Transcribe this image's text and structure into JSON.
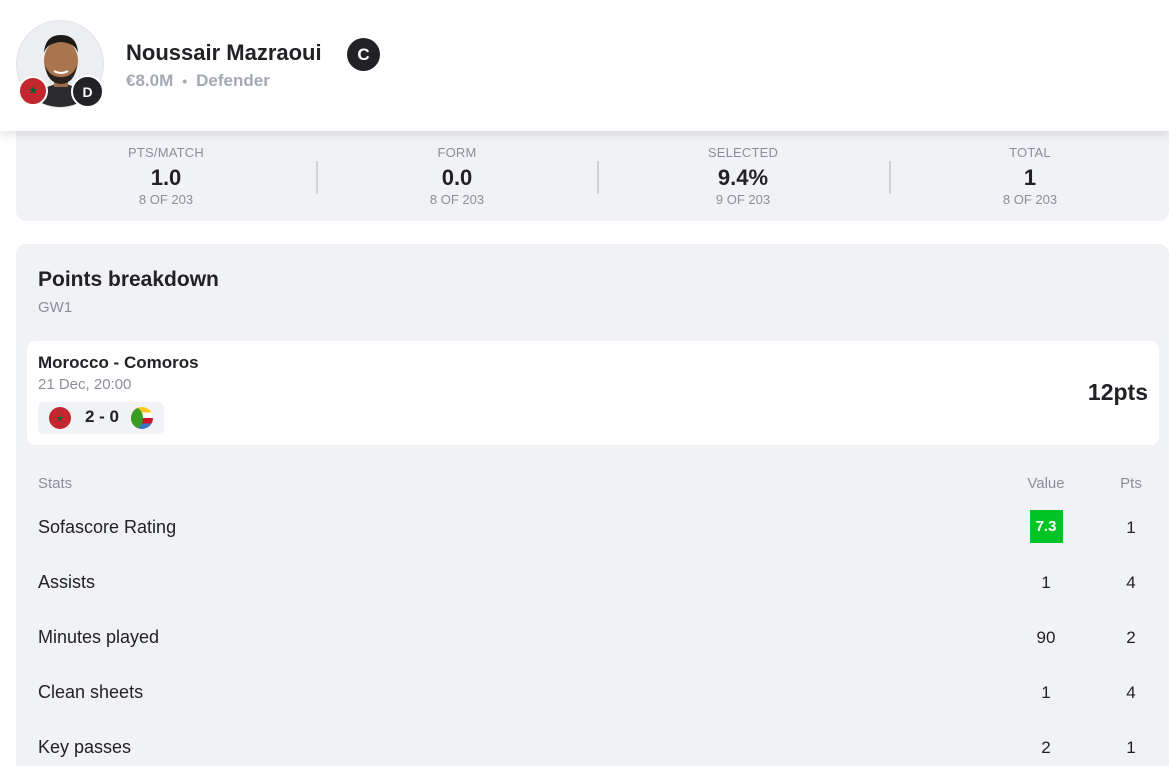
{
  "player": {
    "name": "Noussair Mazraoui",
    "captain_label": "C",
    "position_badge": "D",
    "price": "€8.0M",
    "separator": "•",
    "position": "Defender",
    "flag_icon": "morocco-flag-icon",
    "flag_glyph": "★"
  },
  "summary_stats": [
    {
      "label": "PTS/MATCH",
      "value": "1.0",
      "rank": "8 OF 203"
    },
    {
      "label": "FORM",
      "value": "0.0",
      "rank": "8 OF 203"
    },
    {
      "label": "SELECTED",
      "value": "9.4%",
      "rank": "9 OF 203"
    },
    {
      "label": "TOTAL",
      "value": "1",
      "rank": "8 OF 203"
    }
  ],
  "breakdown": {
    "title": "Points breakdown",
    "gameweek": "GW1",
    "match": {
      "title": "Morocco - Comoros",
      "date": "21 Dec, 20:00",
      "score": "2 - 0",
      "home_flag": "morocco-flag-icon",
      "away_flag": "comoros-flag-icon",
      "points": "12pts"
    },
    "columns": {
      "stat": "Stats",
      "value": "Value",
      "pts": "Pts"
    },
    "rows": [
      {
        "label": "Sofascore Rating",
        "value": "7.3",
        "pts": "1",
        "highlight_color": "#00c424"
      },
      {
        "label": "Assists",
        "value": "1",
        "pts": "4"
      },
      {
        "label": "Minutes played",
        "value": "90",
        "pts": "2"
      },
      {
        "label": "Clean sheets",
        "value": "1",
        "pts": "4"
      },
      {
        "label": "Key passes",
        "value": "2",
        "pts": "1"
      }
    ]
  },
  "colors": {
    "text": "#222226",
    "muted": "#8a8f99",
    "card_bg": "#f1f2f5",
    "rating_green": "#00c424"
  }
}
